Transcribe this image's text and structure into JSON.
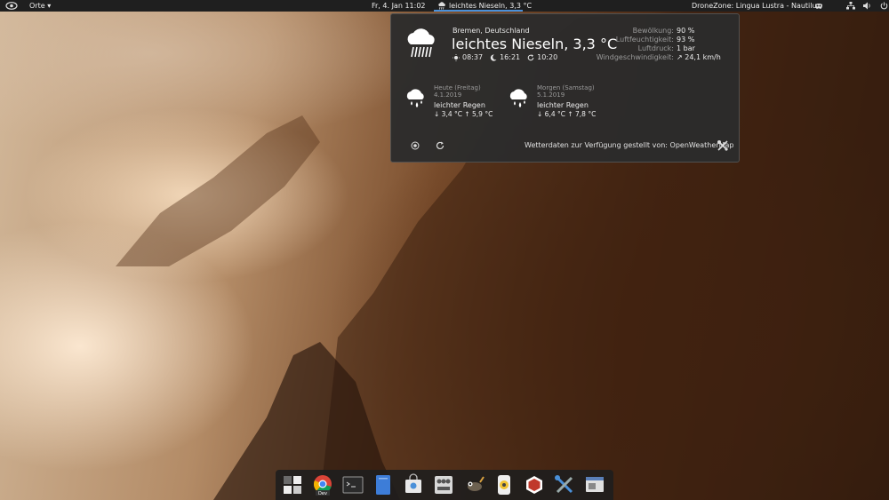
{
  "topbar": {
    "activities_icon": "eye-icon",
    "places_menu": "Orte ▾",
    "clock": "Fr,  4. Jan  11:02",
    "weather_indicator": "leichtes Nieseln, 3,3 °C",
    "active_app": "DroneZone: Lingua Lustra - Nautilus",
    "tray_icons": [
      "mask-icon",
      "network-icon",
      "volume-icon",
      "power-icon",
      "chevron-down-icon"
    ],
    "accent_color": "#4a90d9"
  },
  "weather": {
    "current": {
      "location": "Bremen, Deutschland",
      "description": "leichtes Nieseln, 3,3 °C",
      "sunrise": "08:37",
      "sunset": "16:21",
      "last_update": "10:20",
      "icon": "rain-cloud-icon"
    },
    "details": [
      {
        "label": "Bewölkung:",
        "value": "90 %"
      },
      {
        "label": "Luftfeuchtigkeit:",
        "value": "93 %"
      },
      {
        "label": "Luftdruck:",
        "value": "1 bar"
      },
      {
        "label": "Windgeschwindigkeit:",
        "value": "↗ 24,1 km/h"
      }
    ],
    "forecast": [
      {
        "day": "Heute (Freitag)",
        "date": "4.1.2019",
        "description": "leichter Regen",
        "temps": "↓ 3,4 °C   ↑ 5,9 °C",
        "icon": "rain-drops-icon"
      },
      {
        "day": "Morgen (Samstag)",
        "date": "5.1.2019",
        "description": "leichter Regen",
        "temps": "↓ 6,4 °C   ↑ 7,8 °C",
        "icon": "rain-drops-icon"
      }
    ],
    "attribution": "Wetterdaten zur Verfügung gestellt von:  OpenWeatherMap",
    "buttons": {
      "locations": "location-icon",
      "refresh": "refresh-icon",
      "preferences": "tools-icon"
    }
  },
  "dock": {
    "items": [
      {
        "name": "show-apps",
        "icon": "apps-grid-icon"
      },
      {
        "name": "chrome-dev",
        "icon": "chrome-icon",
        "label": "Dev"
      },
      {
        "name": "terminal",
        "icon": "terminal-icon"
      },
      {
        "name": "files",
        "icon": "files-icon"
      },
      {
        "name": "software",
        "icon": "software-icon"
      },
      {
        "name": "mixer",
        "icon": "mixer-icon"
      },
      {
        "name": "gimp",
        "icon": "gimp-icon"
      },
      {
        "name": "app-yellow",
        "icon": "yellow-app-icon"
      },
      {
        "name": "app-red",
        "icon": "red-hexagon-icon"
      },
      {
        "name": "tools",
        "icon": "tools-icon"
      },
      {
        "name": "screenshot",
        "icon": "window-icon"
      }
    ]
  }
}
